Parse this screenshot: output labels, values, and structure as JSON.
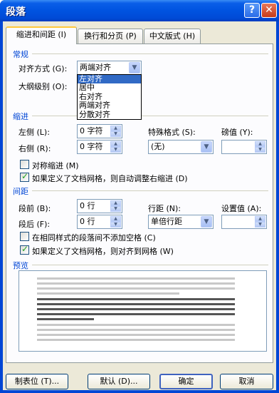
{
  "dialog": {
    "title": "段落",
    "help_label": "?",
    "close_label": "✕"
  },
  "tabs": [
    "缩进和间距 (I)",
    "换行和分页 (P)",
    "中文版式 (H)"
  ],
  "general": {
    "heading": "常规",
    "align_label": "对齐方式 (G):",
    "align_value": "两端对齐",
    "align_options": [
      "左对齐",
      "居中",
      "右对齐",
      "两端对齐",
      "分散对齐"
    ],
    "outline_label": "大纲级别 (O):"
  },
  "indent": {
    "heading": "缩进",
    "left_label": "左侧 (L):",
    "left_value": "0 字符",
    "right_label": "右侧 (R):",
    "right_value": "0 字符",
    "special_label": "特殊格式 (S):",
    "special_value": "(无)",
    "by_label": "磅值 (Y):",
    "by_value": "",
    "mirror_label": "对称缩进 (M)",
    "auto_adjust_label": "如果定义了文档网格，则自动调整右缩进 (D)"
  },
  "spacing": {
    "heading": "间距",
    "before_label": "段前 (B):",
    "before_value": "0 行",
    "after_label": "段后 (F):",
    "after_value": "0 行",
    "line_label": "行距 (N):",
    "line_value": "单倍行距",
    "at_label": "设置值 (A):",
    "at_value": "",
    "no_space_label": "在相同样式的段落间不添加空格 (C)",
    "snap_grid_label": "如果定义了文档网格，则对齐到网格 (W)"
  },
  "preview": {
    "heading": "预览"
  },
  "buttons": {
    "tabs": "制表位 (T)...",
    "default": "默认 (D)...",
    "ok": "确定",
    "cancel": "取消"
  },
  "colors": {
    "title_bar": "#0054e3",
    "section_heading": "#0046d5",
    "selection": "#316ac5",
    "face": "#ece9d8"
  }
}
